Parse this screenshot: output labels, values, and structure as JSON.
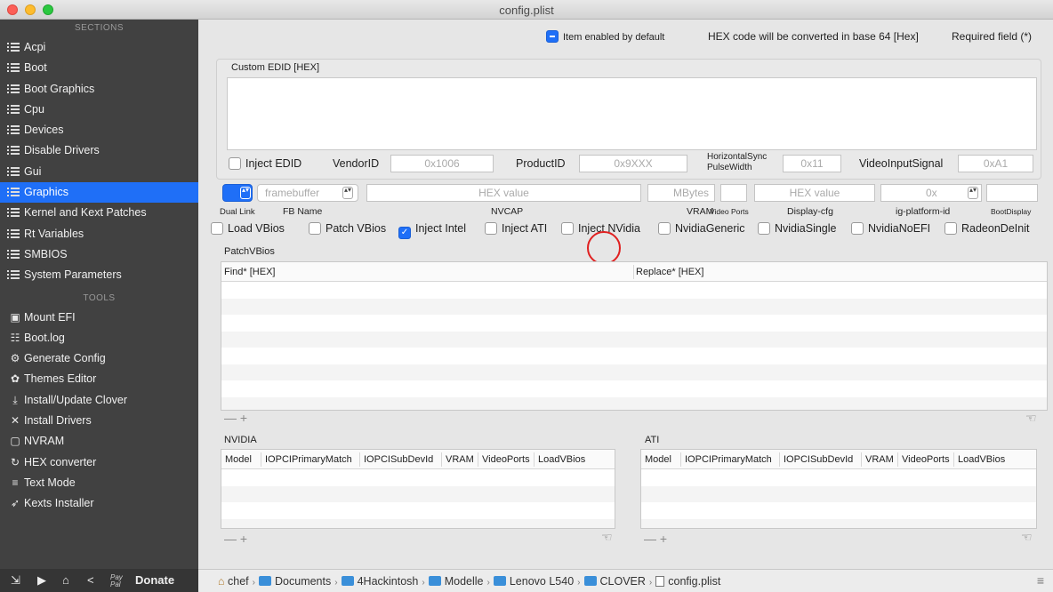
{
  "window": {
    "title": "config.plist"
  },
  "sidebar": {
    "sections_header": "SECTIONS",
    "sections": [
      {
        "label": "Acpi",
        "active": false
      },
      {
        "label": "Boot",
        "active": false
      },
      {
        "label": "Boot Graphics",
        "active": false
      },
      {
        "label": "Cpu",
        "active": false
      },
      {
        "label": "Devices",
        "active": false
      },
      {
        "label": "Disable Drivers",
        "active": false
      },
      {
        "label": "Gui",
        "active": false
      },
      {
        "label": "Graphics",
        "active": true
      },
      {
        "label": "Kernel and Kext Patches",
        "active": false
      },
      {
        "label": "Rt Variables",
        "active": false
      },
      {
        "label": "SMBIOS",
        "active": false
      },
      {
        "label": "System Parameters",
        "active": false
      }
    ],
    "tools_header": "TOOLS",
    "tools": [
      {
        "label": "Mount EFI",
        "icon": "disk-icon"
      },
      {
        "label": "Boot.log",
        "icon": "log-icon"
      },
      {
        "label": "Generate Config",
        "icon": "gears-icon"
      },
      {
        "label": "Themes Editor",
        "icon": "palette-icon"
      },
      {
        "label": "Install/Update Clover",
        "icon": "install-icon"
      },
      {
        "label": "Install Drivers",
        "icon": "tools-icon"
      },
      {
        "label": "NVRAM",
        "icon": "chip-icon"
      },
      {
        "label": "HEX converter",
        "icon": "refresh-icon"
      },
      {
        "label": "Text Mode",
        "icon": "text-icon"
      },
      {
        "label": "Kexts Installer",
        "icon": "rocket-icon"
      }
    ],
    "bottom": {
      "donate_small": "Pay Pal",
      "donate_label": "Donate"
    }
  },
  "header": {
    "enabled_legend": "Item enabled by default",
    "hex_note": "HEX code will be converted in base 64 [Hex]",
    "required_note": "Required field (*)"
  },
  "edid": {
    "group_label": "Custom EDID [HEX]",
    "inject_label": "Inject EDID",
    "vendor_label": "VendorID",
    "vendor_placeholder": "0x1006",
    "product_label": "ProductID",
    "product_placeholder": "0x9XXX",
    "hsync_label_1": "HorizontalSync",
    "hsync_label_2": "PulseWidth",
    "hsync_placeholder": "0x11",
    "vis_label": "VideoInputSignal",
    "vis_placeholder": "0xA1"
  },
  "graphics_row": {
    "framebuffer_placeholder": "framebuffer",
    "hex_placeholder": "HEX value",
    "mbytes_placeholder": "MBytes",
    "displaycfg_placeholder": "HEX value",
    "igplatform_placeholder": "0x",
    "labels": {
      "dual_link": "Dual Link",
      "fb_name": "FB Name",
      "nvcap": "NVCAP",
      "vram": "VRAM",
      "video_ports": "Video Ports",
      "display_cfg": "Display-cfg",
      "ig_platform": "ig-platform-id",
      "boot_display": "BootDisplay"
    }
  },
  "checkboxes": [
    {
      "label": "Load VBios",
      "checked": false
    },
    {
      "label": "Patch VBios",
      "checked": false
    },
    {
      "label": "Inject Intel",
      "checked": true
    },
    {
      "label": "Inject ATI",
      "checked": false
    },
    {
      "label": "Inject NVidia",
      "checked": false
    },
    {
      "label": "NvidiaGeneric",
      "checked": false
    },
    {
      "label": "NvidiaSingle",
      "checked": false
    },
    {
      "label": "NvidiaNoEFI",
      "checked": false
    },
    {
      "label": "RadeonDeInit",
      "checked": false
    }
  ],
  "patchvbios": {
    "label": "PatchVBios",
    "columns": [
      "Find* [HEX]",
      "Replace* [HEX]"
    ],
    "footer": "— +"
  },
  "nvidia": {
    "label": "NVIDIA",
    "columns": [
      "Model",
      "IOPCIPrimaryMatch",
      "IOPCISubDevId",
      "VRAM",
      "VideoPorts",
      "LoadVBios"
    ],
    "footer": "— +"
  },
  "ati": {
    "label": "ATI",
    "columns": [
      "Model",
      "IOPCIPrimaryMatch",
      "IOPCISubDevId",
      "VRAM",
      "VideoPorts",
      "LoadVBios"
    ],
    "footer": "— +"
  },
  "pathbar": {
    "items": [
      "chef",
      "Documents",
      "4Hackintosh",
      "Modelle",
      "Lenovo L540",
      "CLOVER",
      "config.plist"
    ]
  },
  "colors": {
    "accent": "#1f6ff7",
    "sidebar_bg": "#414141",
    "highlight_circle": "#e02020"
  }
}
